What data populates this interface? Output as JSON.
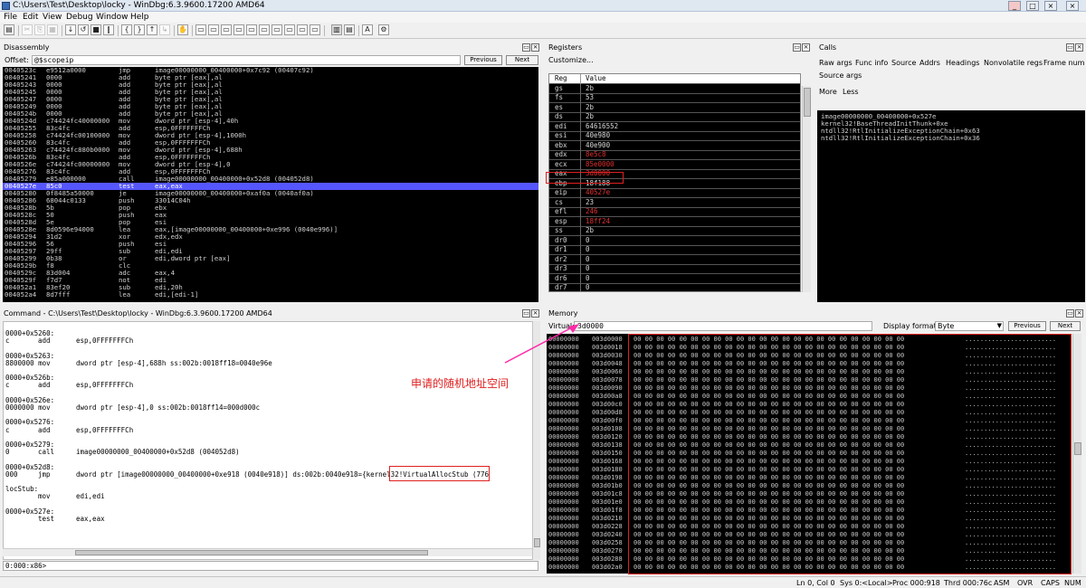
{
  "window": {
    "title": "C:\\Users\\Test\\Desktop\\locky - WinDbg:6.3.9600.17200 AMD64"
  },
  "menu": [
    "File",
    "Edit",
    "View",
    "Debug",
    "Window",
    "Help"
  ],
  "disassembly": {
    "title": "Disassembly",
    "offset_label": "Offset:",
    "offset_value": "@$scopeip",
    "previous_label": "Previous",
    "next_label": "Next",
    "lines": [
      {
        "addr": "0040523c",
        "bytes": "e9512a0000",
        "op": "jmp",
        "args": "image00000000_00400000+0x7c92 (00407c92)"
      },
      {
        "addr": "00405241",
        "bytes": "0000",
        "op": "add",
        "args": "byte ptr [eax],al"
      },
      {
        "addr": "00405243",
        "bytes": "0000",
        "op": "add",
        "args": "byte ptr [eax],al"
      },
      {
        "addr": "00405245",
        "bytes": "0000",
        "op": "add",
        "args": "byte ptr [eax],al"
      },
      {
        "addr": "00405247",
        "bytes": "0000",
        "op": "add",
        "args": "byte ptr [eax],al"
      },
      {
        "addr": "00405249",
        "bytes": "0000",
        "op": "add",
        "args": "byte ptr [eax],al"
      },
      {
        "addr": "0040524b",
        "bytes": "0000",
        "op": "add",
        "args": "byte ptr [eax],al"
      },
      {
        "addr": "0040524d",
        "bytes": "c74424fc40000000",
        "op": "mov",
        "args": "dword ptr [esp-4],40h"
      },
      {
        "addr": "00405255",
        "bytes": "83c4fc",
        "op": "add",
        "args": "esp,0FFFFFFFCh"
      },
      {
        "addr": "00405258",
        "bytes": "c74424fc00100000",
        "op": "mov",
        "args": "dword ptr [esp-4],1000h"
      },
      {
        "addr": "00405260",
        "bytes": "83c4fc",
        "op": "add",
        "args": "esp,0FFFFFFFCh"
      },
      {
        "addr": "00405263",
        "bytes": "c74424fc880b0000",
        "op": "mov",
        "args": "dword ptr [esp-4],688h"
      },
      {
        "addr": "0040526b",
        "bytes": "83c4fc",
        "op": "add",
        "args": "esp,0FFFFFFFCh"
      },
      {
        "addr": "0040526e",
        "bytes": "c74424fc00000000",
        "op": "mov",
        "args": "dword ptr [esp-4],0"
      },
      {
        "addr": "00405276",
        "bytes": "83c4fc",
        "op": "add",
        "args": "esp,0FFFFFFFCh"
      },
      {
        "addr": "00405279",
        "bytes": "e85a000000",
        "op": "call",
        "args": "image00000000_00400000+0x52d8 (004052d8)"
      },
      {
        "addr": "0040527e",
        "bytes": "85c0",
        "op": "test",
        "args": "eax,eax"
      },
      {
        "addr": "00405280",
        "bytes": "0f8485a50000",
        "op": "je",
        "args": "image00000000_00400000+0xaf0a (0040af0a)"
      },
      {
        "addr": "00405286",
        "bytes": "68044c0133",
        "op": "push",
        "args": "33014C04h"
      },
      {
        "addr": "0040528b",
        "bytes": "5b",
        "op": "pop",
        "args": "ebx"
      },
      {
        "addr": "0040528c",
        "bytes": "50",
        "op": "push",
        "args": "eax"
      },
      {
        "addr": "0040528d",
        "bytes": "5e",
        "op": "pop",
        "args": "esi"
      },
      {
        "addr": "0040528e",
        "bytes": "8d0596e94000",
        "op": "lea",
        "args": "eax,[image00000000_00400000+0xe996 (0040e996)]"
      },
      {
        "addr": "00405294",
        "bytes": "31d2",
        "op": "xor",
        "args": "edx,edx"
      },
      {
        "addr": "00405296",
        "bytes": "56",
        "op": "push",
        "args": "esi"
      },
      {
        "addr": "00405297",
        "bytes": "29ff",
        "op": "sub",
        "args": "edi,edi"
      },
      {
        "addr": "00405299",
        "bytes": "0b38",
        "op": "or",
        "args": "edi,dword ptr [eax]"
      },
      {
        "addr": "0040529b",
        "bytes": "f8",
        "op": "clc",
        "args": ""
      },
      {
        "addr": "0040529c",
        "bytes": "83d004",
        "op": "adc",
        "args": "eax,4"
      },
      {
        "addr": "0040529f",
        "bytes": "f7d7",
        "op": "not",
        "args": "edi"
      },
      {
        "addr": "004052a1",
        "bytes": "83ef20",
        "op": "sub",
        "args": "edi,20h"
      },
      {
        "addr": "004052a4",
        "bytes": "8d7fff",
        "op": "lea",
        "args": "edi,[edi-1]"
      }
    ]
  },
  "registers": {
    "title": "Registers",
    "customize_label": "Customize...",
    "col_reg": "Reg",
    "col_value": "Value",
    "rows": [
      {
        "reg": "gs",
        "value": "2b",
        "changed": false
      },
      {
        "reg": "fs",
        "value": "53",
        "changed": false
      },
      {
        "reg": "es",
        "value": "2b",
        "changed": false
      },
      {
        "reg": "ds",
        "value": "2b",
        "changed": false
      },
      {
        "reg": "edi",
        "value": "64616552",
        "changed": false
      },
      {
        "reg": "esi",
        "value": "40e980",
        "changed": false
      },
      {
        "reg": "ebx",
        "value": "40e900",
        "changed": false
      },
      {
        "reg": "edx",
        "value": "8e5c8",
        "changed": true
      },
      {
        "reg": "ecx",
        "value": "85e0000",
        "changed": true
      },
      {
        "reg": "eax",
        "value": "3d0000",
        "changed": true
      },
      {
        "reg": "ebp",
        "value": "18f188",
        "changed": false
      },
      {
        "reg": "eip",
        "value": "40527e",
        "changed": true
      },
      {
        "reg": "cs",
        "value": "23",
        "changed": false
      },
      {
        "reg": "efl",
        "value": "246",
        "changed": true
      },
      {
        "reg": "esp",
        "value": "18ff24",
        "changed": true
      },
      {
        "reg": "ss",
        "value": "2b",
        "changed": false
      },
      {
        "reg": "dr0",
        "value": "0",
        "changed": false
      },
      {
        "reg": "dr1",
        "value": "0",
        "changed": false
      },
      {
        "reg": "dr2",
        "value": "0",
        "changed": false
      },
      {
        "reg": "dr3",
        "value": "0",
        "changed": false
      },
      {
        "reg": "dr6",
        "value": "0",
        "changed": false
      },
      {
        "reg": "dr7",
        "value": "0",
        "changed": false
      }
    ]
  },
  "calls": {
    "title": "Calls",
    "links": [
      "Raw args",
      "Func info",
      "Source",
      "Addrs",
      "Headings",
      "Nonvolatile regs",
      "Frame num"
    ],
    "source_args": "Source args",
    "more": "More",
    "less": "Less",
    "frames": [
      "image00000000_00400000+0x527e",
      "kernel32!BaseThreadInitThunk+0xe",
      "ntdll32!RtlInitializeExceptionChain+0x63",
      "ntdll32!RtlInitializeExceptionChain+0x36"
    ]
  },
  "command": {
    "title": "Command - C:\\Users\\Test\\Desktop\\locky - WinDbg:6.3.9600.17200 AMD64",
    "prompt": "0:000:x86>",
    "lines": [
      {
        "t": "0000+0x5260:",
        "op": "",
        "args": ""
      },
      {
        "t": "c",
        "op": "add",
        "args": "esp,0FFFFFFFCh"
      },
      {
        "t": "",
        "op": "",
        "args": ""
      },
      {
        "t": "0000+0x5263:",
        "op": "",
        "args": ""
      },
      {
        "t": "8800000 mov",
        "op": "",
        "args": "dword ptr [esp-4],688h ss:002b:0018ff18=0040e96e"
      },
      {
        "t": "",
        "op": "",
        "args": ""
      },
      {
        "t": "0000+0x526b:",
        "op": "",
        "args": ""
      },
      {
        "t": "c",
        "op": "add",
        "args": "esp,0FFFFFFFCh"
      },
      {
        "t": "",
        "op": "",
        "args": ""
      },
      {
        "t": "0000+0x526e:",
        "op": "",
        "args": ""
      },
      {
        "t": "0000000 mov",
        "op": "",
        "args": "dword ptr [esp-4],0 ss:002b:0018ff14=000d000c"
      },
      {
        "t": "",
        "op": "",
        "args": ""
      },
      {
        "t": "0000+0x5276:",
        "op": "",
        "args": ""
      },
      {
        "t": "c",
        "op": "add",
        "args": "esp,0FFFFFFFCh"
      },
      {
        "t": "",
        "op": "",
        "args": ""
      },
      {
        "t": "0000+0x5279:",
        "op": "",
        "args": ""
      },
      {
        "t": "0",
        "op": "call",
        "args": "image00000000_00400000+0x52d8 (004052d8)"
      },
      {
        "t": "",
        "op": "",
        "args": ""
      },
      {
        "t": "0000+0x52d8:",
        "op": "",
        "args": ""
      },
      {
        "t": "000",
        "op": "jmp",
        "args": "dword ptr [image00000000_00400000+0xe918 (0040e918)] ds:002b:0040e918={kernel32!VirtualAllocStub (776"
      },
      {
        "t": "",
        "op": "",
        "args": ""
      },
      {
        "t": "locStub:",
        "op": "",
        "args": ""
      },
      {
        "t": "",
        "op": "mov",
        "args": "edi,edi"
      },
      {
        "t": "",
        "op": "",
        "args": ""
      },
      {
        "t": "0000+0x527e:",
        "op": "",
        "args": ""
      },
      {
        "t": "",
        "op": "test",
        "args": "eax,eax"
      }
    ]
  },
  "memory": {
    "title": "Memory",
    "virtual_label": "Virtual:",
    "virtual_value": "3d0000",
    "display_format_label": "Display format:",
    "display_format_value": "Byte",
    "previous_label": "Previous",
    "next_label": "Next",
    "rows": [
      "003d0000",
      "003d0018",
      "003d0030",
      "003d0048",
      "003d0060",
      "003d0078",
      "003d0090",
      "003d00a8",
      "003d00c0",
      "003d00d8",
      "003d00f0",
      "003d0108",
      "003d0120",
      "003d0138",
      "003d0150",
      "003d0168",
      "003d0180",
      "003d0198",
      "003d01b0",
      "003d01c8",
      "003d01e0",
      "003d01f8",
      "003d0210",
      "003d0228",
      "003d0240",
      "003d0258",
      "003d0270",
      "003d0288",
      "003d02a0"
    ],
    "zero_bytes": "00 00 00 00 00 00 00 00 00 00 00 00 00 00 00 00 00 00 00 00 00 00 00 00",
    "ascii": "........................"
  },
  "annotation": {
    "text": "申请的随机地址空间",
    "color": "#e02020"
  },
  "statusbar": {
    "ln_col": "Ln 0, Col 0",
    "sys": "Sys 0:<Local>",
    "proc": "Proc 000:918",
    "thrd": "Thrd 000:76c",
    "asm": "ASM",
    "ovr": "OVR",
    "caps": "CAPS",
    "num": "NUM"
  }
}
